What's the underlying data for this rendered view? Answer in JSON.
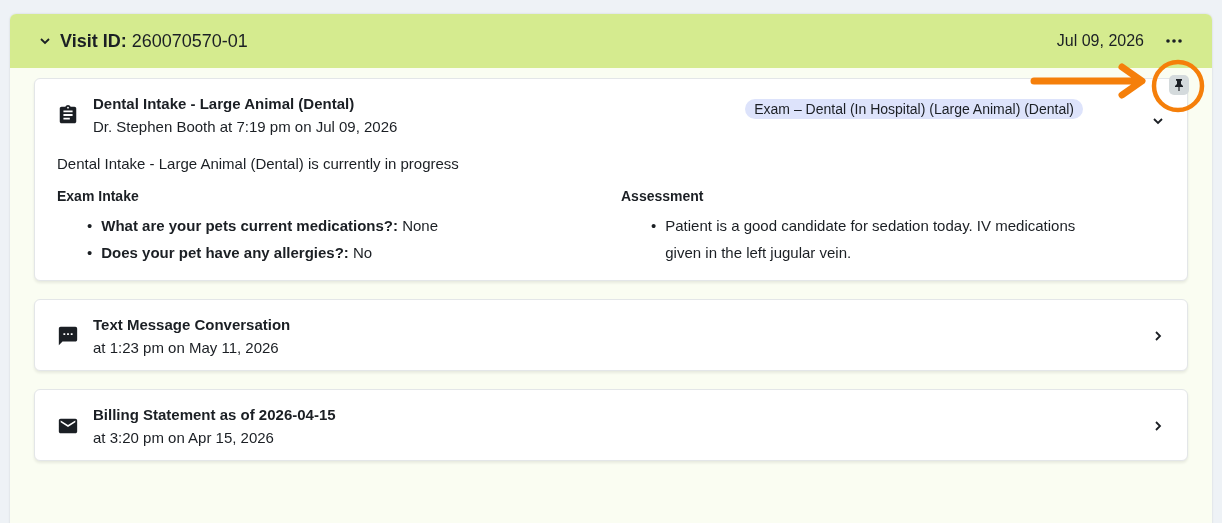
{
  "visit": {
    "label": "Visit ID:",
    "id": "260070570-01",
    "date": "Jul 09, 2026",
    "expanded": true
  },
  "entries": [
    {
      "kind": "intake",
      "title": "Dental Intake - Large Animal (Dental)",
      "subtitle": "Dr. Stephen Booth at 7:19 pm on Jul 09, 2026",
      "tag": "Exam – Dental (In Hospital) (Large Animal) (Dental)",
      "expanded": true,
      "status": "Dental Intake - Large Animal (Dental) is currently in progress",
      "sections": [
        {
          "heading": "Exam Intake",
          "bullet": "•",
          "items": [
            "**What are your pets current medications?:** None",
            "**Does your pet have any allergies?:** No"
          ]
        },
        {
          "heading": "Assessment",
          "bullet": "•",
          "items": [
            "Patient is a good candidate for sedation today. IV medications given in the left jugular vein."
          ]
        }
      ]
    },
    {
      "kind": "text",
      "title": "Text Message Conversation",
      "subtitle": "at 1:23 pm on May 11, 2026",
      "expanded": false
    },
    {
      "kind": "email",
      "title": "Billing Statement as of 2026-04-15",
      "subtitle": "at 3:20 pm on Apr 15, 2026",
      "expanded": false
    }
  ]
}
